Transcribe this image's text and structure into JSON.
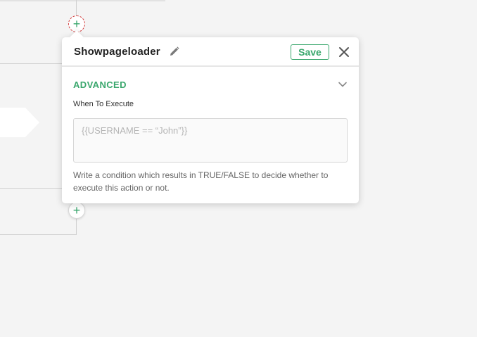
{
  "canvas": {
    "add_step_symbol": "+"
  },
  "panel": {
    "title": "Showpageloader",
    "save_label": "Save",
    "section": {
      "title": "ADVANCED",
      "field_label": "When To Execute",
      "input_value": "",
      "input_placeholder": "{{USERNAME == “John”}}",
      "help_text": "Write a condition which results in TRUE/FALSE to decide whether to execute this action or not."
    }
  },
  "icons": {
    "edit": "pencil-icon",
    "close": "close-icon",
    "expand": "chevron-down-icon",
    "add": "plus-icon"
  },
  "colors": {
    "accent": "#3aa76d",
    "background": "#f4f4f4",
    "dashed_border": "#d23c3c"
  }
}
